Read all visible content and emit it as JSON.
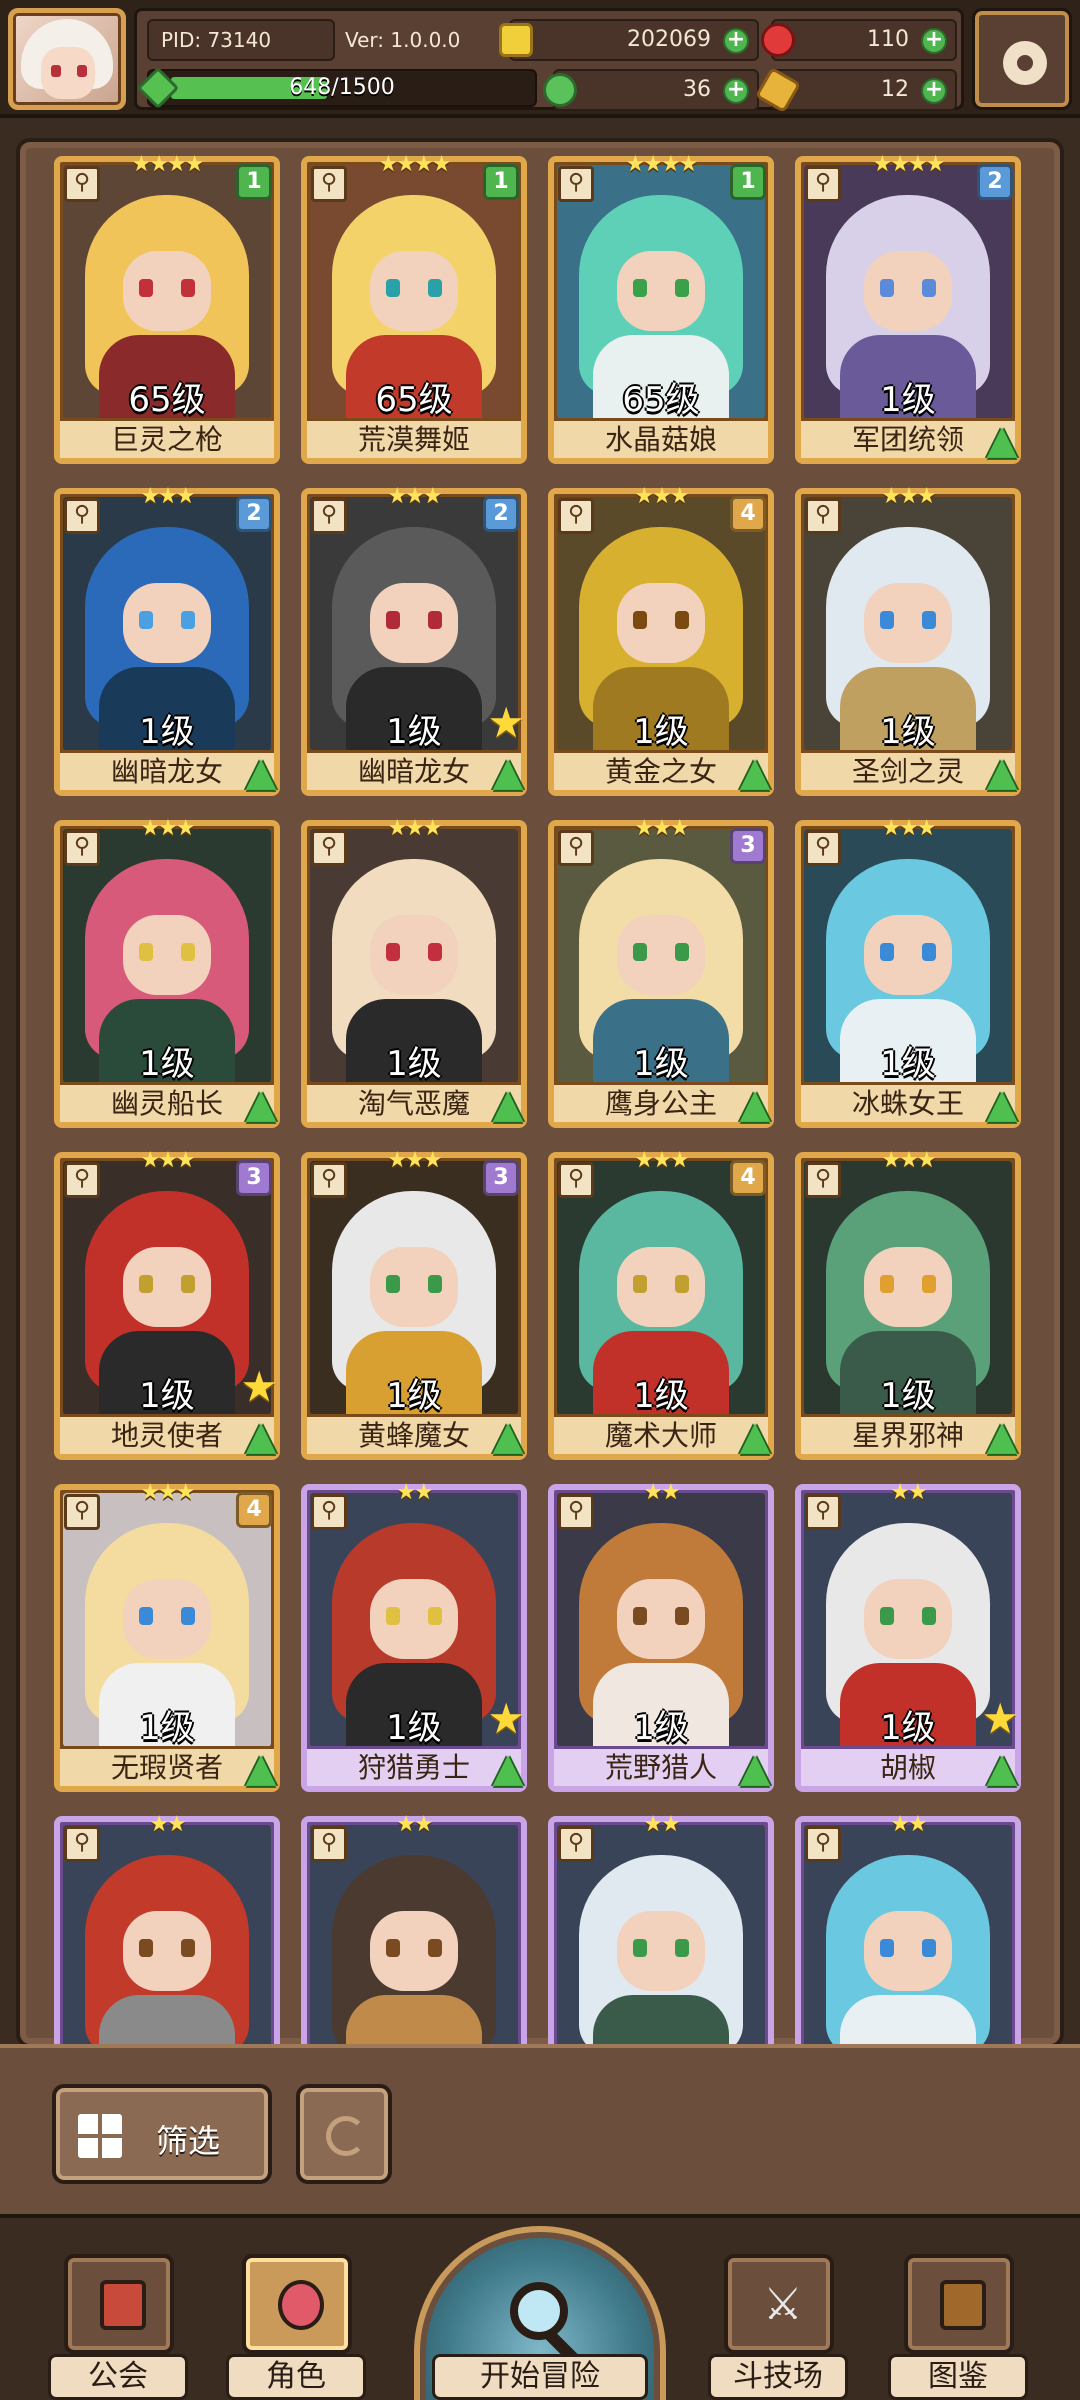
{
  "header": {
    "pid": "PID: 73140",
    "version": "Ver: 1.0.0.0",
    "coins": "202069",
    "gems": "110",
    "clovers": "36",
    "keys": "12",
    "energy": "648/1500",
    "energy_fraction": 0.432
  },
  "cards": [
    {
      "name": "巨灵之枪",
      "level": "65级",
      "stars": "★★★★",
      "badge": "1",
      "badge_color": "#4fb54f",
      "frame": "gold",
      "upgrade": false,
      "fav": false,
      "hair": "#f1c45a",
      "body": "#8a2a2a",
      "eye": "#c2303a",
      "bg": "#5d4636"
    },
    {
      "name": "荒漠舞姬",
      "level": "65级",
      "stars": "★★★★",
      "badge": "1",
      "badge_color": "#4fb54f",
      "frame": "gold",
      "upgrade": false,
      "fav": false,
      "hair": "#f4d26a",
      "body": "#c23a2a",
      "eye": "#2aa0a8",
      "bg": "#7a4a30"
    },
    {
      "name": "水晶菇娘",
      "level": "65级",
      "stars": "★★★★",
      "badge": "1",
      "badge_color": "#4fb54f",
      "frame": "gold",
      "upgrade": false,
      "fav": false,
      "hair": "#5ed0b8",
      "body": "#e8f0f0",
      "eye": "#3aa04a",
      "bg": "#3a7088"
    },
    {
      "name": "军团统领",
      "level": "1级",
      "stars": "★★★★",
      "badge": "2",
      "badge_color": "#5a9ad8",
      "frame": "gold",
      "upgrade": true,
      "fav": false,
      "hair": "#d8d0e8",
      "body": "#6a5a9a",
      "eye": "#5a8ad8",
      "bg": "#4a3a5a"
    },
    {
      "name": "幽暗龙女",
      "level": "1级",
      "stars": "★★★",
      "badge": "2",
      "badge_color": "#5a9ad8",
      "frame": "gold",
      "upgrade": true,
      "fav": false,
      "hair": "#2a6ab8",
      "body": "#1a3a5a",
      "eye": "#4aa0e0",
      "bg": "#2a3a48"
    },
    {
      "name": "幽暗龙女",
      "level": "1级",
      "stars": "★★★",
      "badge": "2",
      "badge_color": "#5a9ad8",
      "frame": "gold",
      "upgrade": true,
      "fav": true,
      "hair": "#5a5a5a",
      "body": "#2a2a2a",
      "eye": "#b02a3a",
      "bg": "#3a3a3a"
    },
    {
      "name": "黄金之女",
      "level": "1级",
      "stars": "★★★",
      "badge": "4",
      "badge_color": "#e0a84a",
      "frame": "gold",
      "upgrade": true,
      "fav": false,
      "hair": "#d8b030",
      "body": "#a07a20",
      "eye": "#7a4a10",
      "bg": "#5a4a2a"
    },
    {
      "name": "圣剑之灵",
      "level": "1级",
      "stars": "★★★",
      "badge": "",
      "badge_color": "",
      "frame": "gold",
      "upgrade": true,
      "fav": false,
      "hair": "#e0e8f0",
      "body": "#c0a060",
      "eye": "#3a8ad8",
      "bg": "#4a4438"
    },
    {
      "name": "幽灵船长",
      "level": "1级",
      "stars": "★★★",
      "badge": "",
      "badge_color": "",
      "frame": "gold",
      "upgrade": true,
      "fav": false,
      "hair": "#d85a7a",
      "body": "#2a4a3a",
      "eye": "#e0c040",
      "bg": "#2a3a30"
    },
    {
      "name": "淘气恶魔",
      "level": "1级",
      "stars": "★★★",
      "badge": "",
      "badge_color": "",
      "frame": "gold",
      "upgrade": true,
      "fav": false,
      "hair": "#f2dcc0",
      "body": "#2a2a2a",
      "eye": "#c23040",
      "bg": "#4a3a34"
    },
    {
      "name": "鹰身公主",
      "level": "1级",
      "stars": "★★★",
      "badge": "3",
      "badge_color": "#a07ad0",
      "frame": "gold",
      "upgrade": true,
      "fav": false,
      "hair": "#f2dca8",
      "body": "#3a7088",
      "eye": "#3a9a4a",
      "bg": "#5a5a40"
    },
    {
      "name": "冰蛛女王",
      "level": "1级",
      "stars": "★★★",
      "badge": "",
      "badge_color": "",
      "frame": "gold",
      "upgrade": true,
      "fav": false,
      "hair": "#6ac8e0",
      "body": "#e8f0f4",
      "eye": "#3a8ad8",
      "bg": "#2a4a58"
    },
    {
      "name": "地灵使者",
      "level": "1级",
      "stars": "★★★",
      "badge": "3",
      "badge_color": "#a07ad0",
      "frame": "gold",
      "upgrade": true,
      "fav": true,
      "hair": "#c2302a",
      "body": "#2a2a2a",
      "eye": "#c2a030",
      "bg": "#3a2e28"
    },
    {
      "name": "黄蜂魔女",
      "level": "1级",
      "stars": "★★★",
      "badge": "3",
      "badge_color": "#a07ad0",
      "frame": "gold",
      "upgrade": true,
      "fav": false,
      "hair": "#e8e8e8",
      "body": "#d8a030",
      "eye": "#3a9a4a",
      "bg": "#3a2e20"
    },
    {
      "name": "魔术大师",
      "level": "1级",
      "stars": "★★★",
      "badge": "4",
      "badge_color": "#e0a84a",
      "frame": "gold",
      "upgrade": true,
      "fav": false,
      "hair": "#5ab8a0",
      "body": "#c2302a",
      "eye": "#c2a030",
      "bg": "#2a3a30"
    },
    {
      "name": "星界邪神",
      "level": "1级",
      "stars": "★★★",
      "badge": "",
      "badge_color": "",
      "frame": "gold",
      "upgrade": true,
      "fav": false,
      "hair": "#5aa078",
      "body": "#3a5a4a",
      "eye": "#e0a030",
      "bg": "#2a3830"
    },
    {
      "name": "无瑕贤者",
      "level": "1级",
      "stars": "★★★",
      "badge": "4",
      "badge_color": "#e0a84a",
      "frame": "gold",
      "upgrade": true,
      "fav": false,
      "hair": "#f4dca0",
      "body": "#f0f0f0",
      "eye": "#3a8ad8",
      "bg": "#c8c0c0"
    },
    {
      "name": "狩猎勇士",
      "level": "1级",
      "stars": "★★",
      "badge": "",
      "badge_color": "",
      "frame": "purple",
      "upgrade": true,
      "fav": true,
      "hair": "#b83a2a",
      "body": "#2a2a2a",
      "eye": "#e0c040",
      "bg": "#3a4458"
    },
    {
      "name": "荒野猎人",
      "level": "1级",
      "stars": "★★",
      "badge": "",
      "badge_color": "",
      "frame": "purple",
      "upgrade": true,
      "fav": false,
      "hair": "#c07a3a",
      "body": "#f0e8e0",
      "eye": "#7a4a20",
      "bg": "#3a3a48"
    },
    {
      "name": "胡椒",
      "level": "1级",
      "stars": "★★",
      "badge": "",
      "badge_color": "",
      "frame": "purple",
      "upgrade": true,
      "fav": true,
      "hair": "#e8e8e8",
      "body": "#c2302a",
      "eye": "#3a9a4a",
      "bg": "#3a4458"
    },
    {
      "name": "",
      "level": "",
      "stars": "★★",
      "badge": "",
      "badge_color": "",
      "frame": "purple",
      "upgrade": false,
      "fav": false,
      "hair": "#c23a2a",
      "body": "#8a8a8a",
      "eye": "#7a4a20",
      "bg": "#3a4458"
    },
    {
      "name": "",
      "level": "",
      "stars": "★★",
      "badge": "",
      "badge_color": "",
      "frame": "purple",
      "upgrade": false,
      "fav": false,
      "hair": "#4a3a30",
      "body": "#c08a4a",
      "eye": "#7a4a20",
      "bg": "#3a4458"
    },
    {
      "name": "",
      "level": "",
      "stars": "★★",
      "badge": "",
      "badge_color": "",
      "frame": "purple",
      "upgrade": false,
      "fav": false,
      "hair": "#e0e8f0",
      "body": "#3a5a4a",
      "eye": "#3a9a4a",
      "bg": "#3a4458"
    },
    {
      "name": "",
      "level": "",
      "stars": "★★",
      "badge": "",
      "badge_color": "",
      "frame": "purple",
      "upgrade": false,
      "fav": false,
      "hair": "#6ac8e0",
      "body": "#e8f0f4",
      "eye": "#3a8ad8",
      "bg": "#3a4458"
    }
  ],
  "controls": {
    "filter_label": "筛选"
  },
  "nav": {
    "guild": "公会",
    "characters": "角色",
    "adventure": "开始冒险",
    "arena": "斗技场",
    "codex": "图鉴"
  }
}
